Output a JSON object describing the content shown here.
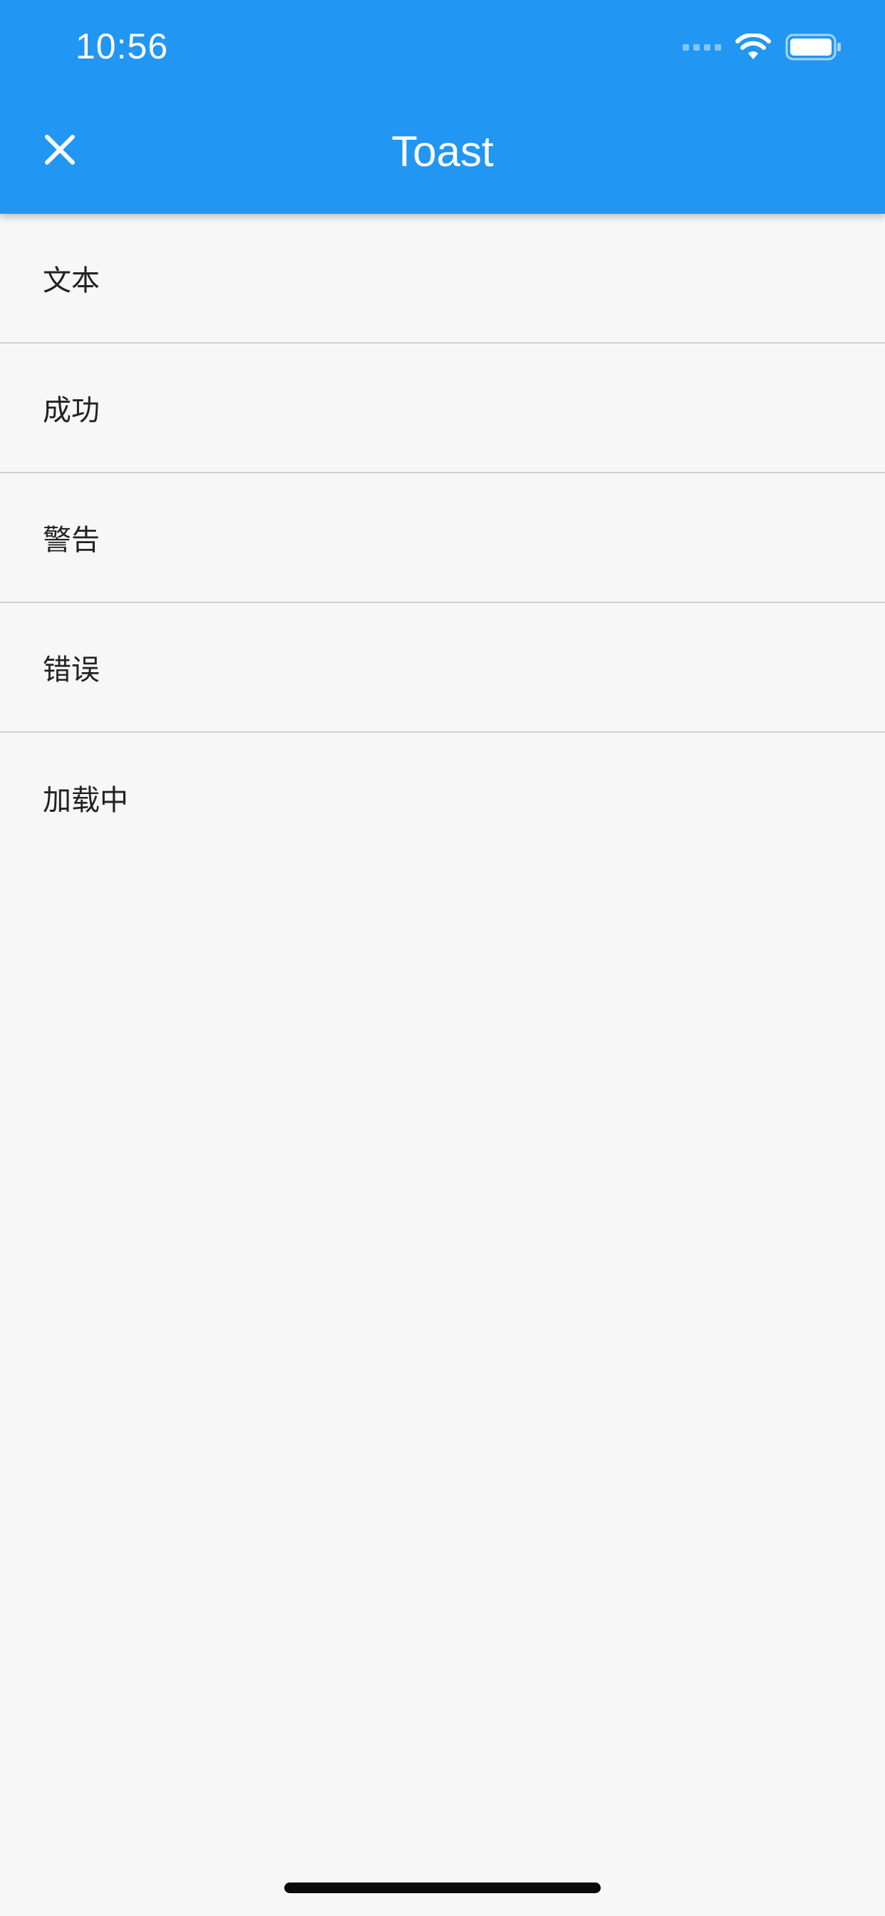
{
  "status_bar": {
    "time": "10:56",
    "icons": [
      "cellular-signal-icon",
      "wifi-icon",
      "battery-icon"
    ]
  },
  "header": {
    "title": "Toast",
    "close_icon": "close-icon",
    "background_color": "#2196F3"
  },
  "list": {
    "items": [
      {
        "label": "文本"
      },
      {
        "label": "成功"
      },
      {
        "label": "警告"
      },
      {
        "label": "错误"
      },
      {
        "label": "加载中"
      }
    ]
  }
}
